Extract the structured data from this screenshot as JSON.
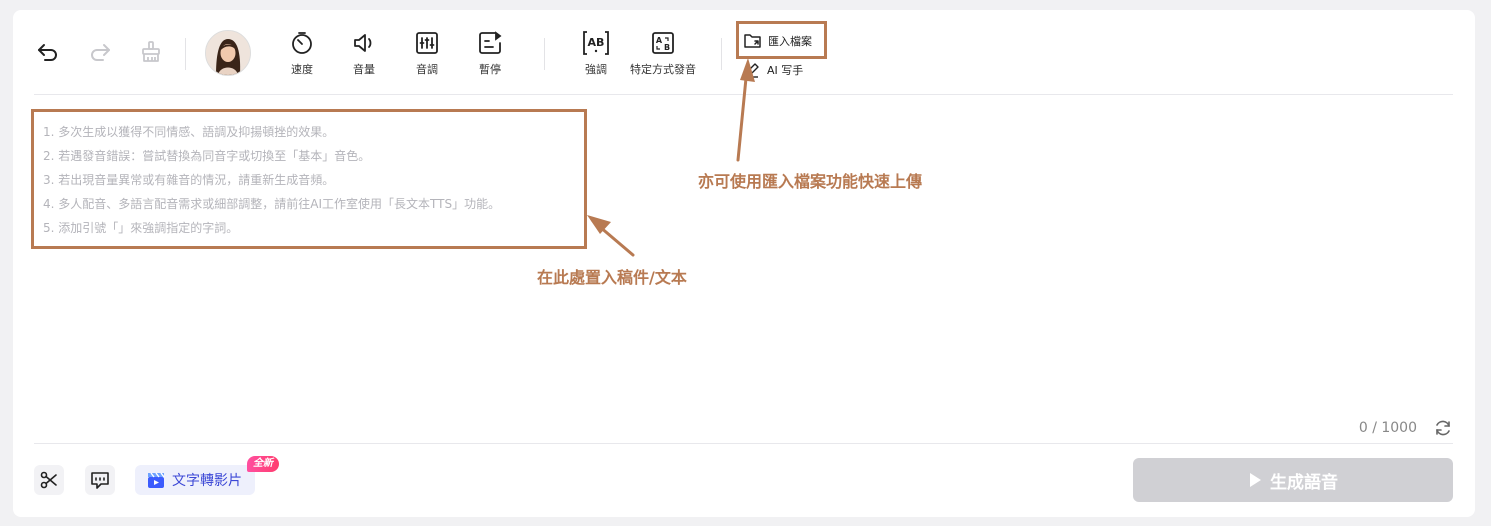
{
  "toolbar": {
    "undo_icon": "undo-icon",
    "redo_icon": "redo-icon",
    "clear_icon": "broom-icon",
    "tools": [
      {
        "label": "速度",
        "icon": "speed-gauge-icon"
      },
      {
        "label": "音量",
        "icon": "speaker-icon"
      },
      {
        "label": "音調",
        "icon": "equalizer-icon"
      },
      {
        "label": "暫停",
        "icon": "pause-insert-icon"
      },
      {
        "label": "強調",
        "icon": "emphasis-ab-icon"
      },
      {
        "label": "特定方式發音",
        "icon": "pronunciation-ab-icon"
      }
    ],
    "import_file": "匯入檔案",
    "ai_writer": "AI 写手"
  },
  "editor": {
    "hints": [
      "1. 多次生成以獲得不同情感、語調及抑揚頓挫的效果。",
      "2. 若遇發音錯誤：嘗試替換為同音字或切換至「基本」音色。",
      "3. 若出現音量異常或有雜音的情況，請重新生成音頻。",
      "4. 多人配音、多語言配音需求或細部調整，請前往AI工作室使用「長文本TTS」功能。",
      "5. 添加引號「」來強調指定的字詞。"
    ],
    "counter": "0 / 1000"
  },
  "annotations": {
    "import_note": "亦可使用匯入檔案功能快速上傳",
    "script_note": "在此處置入稿件/文本"
  },
  "bottom": {
    "text_to_video": "文字轉影片",
    "new_badge": "全新",
    "generate": "生成語音"
  },
  "colors": {
    "annotation": "#b87a52",
    "accent": "#3c48d6",
    "disabled_button": "#d0d0d4"
  }
}
